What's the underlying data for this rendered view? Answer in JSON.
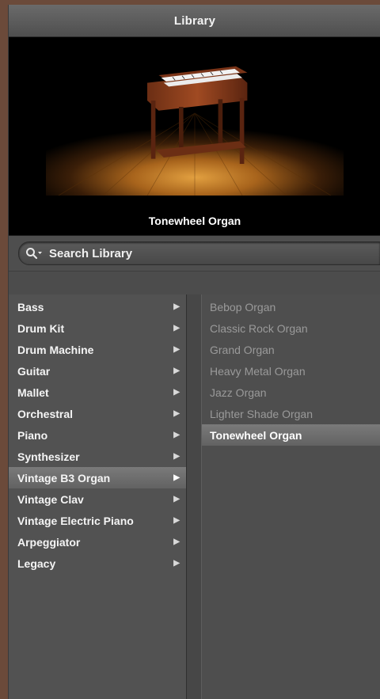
{
  "window": {
    "title": "Library"
  },
  "preview": {
    "caption": "Tonewheel Organ",
    "image_icon": "organ-icon"
  },
  "search": {
    "placeholder": "Search Library",
    "icon": "search-icon"
  },
  "categories": [
    {
      "label": "Bass",
      "selected": false
    },
    {
      "label": "Drum Kit",
      "selected": false
    },
    {
      "label": "Drum Machine",
      "selected": false
    },
    {
      "label": "Guitar",
      "selected": false
    },
    {
      "label": "Mallet",
      "selected": false
    },
    {
      "label": "Orchestral",
      "selected": false
    },
    {
      "label": "Piano",
      "selected": false
    },
    {
      "label": "Synthesizer",
      "selected": false
    },
    {
      "label": "Vintage B3 Organ",
      "selected": true
    },
    {
      "label": "Vintage Clav",
      "selected": false
    },
    {
      "label": "Vintage Electric Piano",
      "selected": false
    },
    {
      "label": "Arpeggiator",
      "selected": false
    },
    {
      "label": "Legacy",
      "selected": false
    }
  ],
  "presets": [
    {
      "label": "Bebop Organ",
      "selected": false
    },
    {
      "label": "Classic Rock Organ",
      "selected": false
    },
    {
      "label": "Grand Organ",
      "selected": false
    },
    {
      "label": "Heavy Metal Organ",
      "selected": false
    },
    {
      "label": "Jazz Organ",
      "selected": false
    },
    {
      "label": "Lighter Shade Organ",
      "selected": false
    },
    {
      "label": "Tonewheel Organ",
      "selected": true
    }
  ],
  "colors": {
    "selection": "#6e6e6e",
    "panel": "#525252",
    "dimmed_text": "#9a9a9a"
  }
}
